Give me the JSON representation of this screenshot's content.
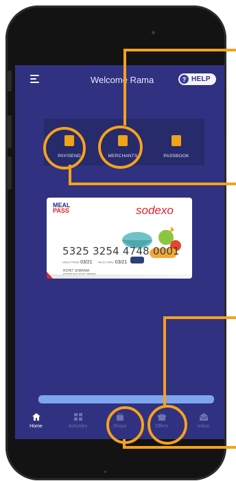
{
  "header": {
    "title": "Welcome Rama",
    "help_label": "HELP",
    "help_glyph": "?"
  },
  "quick_actions": [
    {
      "label": "PAY/SEND",
      "icon": "phone-send-icon"
    },
    {
      "label": "MERCHANTS",
      "icon": "store-icon"
    },
    {
      "label": "PASSBOOK",
      "icon": "passbook-icon"
    }
  ],
  "card": {
    "logo_top": "MEAL",
    "logo_bottom": "PASS",
    "brand": "sodexo",
    "number": "5325 3254 4748 0001",
    "valid_from_label": "VALID FROM",
    "valid_from": "03/21",
    "valid_thru_label": "VALID THRU",
    "valid_thru": "03/21",
    "holder_name": "ROHIT SHARMA",
    "company": "SODEXO SVC INDIA"
  },
  "nav": [
    {
      "label": "Home",
      "icon": "home-icon",
      "active": true
    },
    {
      "label": "Activities",
      "icon": "grid-icon",
      "active": false
    },
    {
      "label": "Shops",
      "icon": "bag-icon",
      "active": false
    },
    {
      "label": "Offers",
      "icon": "gift-icon",
      "active": false
    },
    {
      "label": "Inbox",
      "icon": "envelope-icon",
      "active": false
    }
  ],
  "colors": {
    "screen_bg": "#303180",
    "accent": "#f0a318",
    "annotation": "#f5a21c",
    "brand_red": "#e31f2d"
  }
}
